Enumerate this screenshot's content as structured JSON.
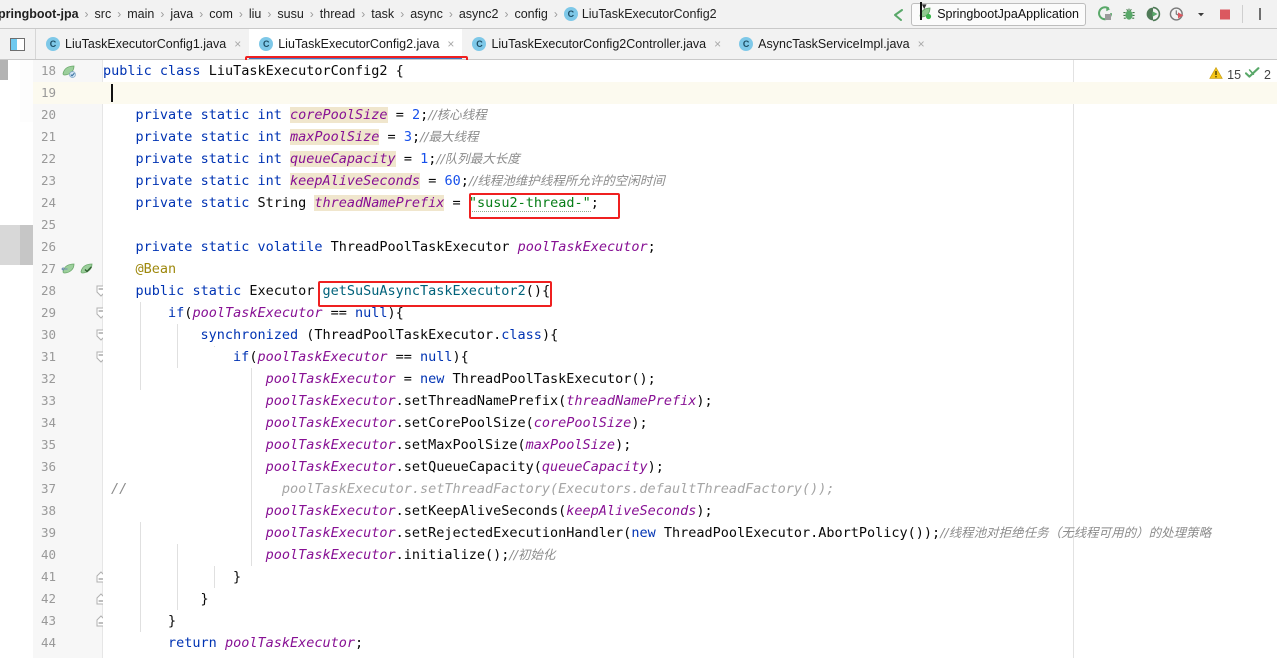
{
  "breadcrumb": {
    "items": [
      {
        "label": "pringboot-jpa",
        "icon": null
      },
      {
        "label": "src",
        "icon": null
      },
      {
        "label": "main",
        "icon": null
      },
      {
        "label": "java",
        "icon": null
      },
      {
        "label": "com",
        "icon": null
      },
      {
        "label": "liu",
        "icon": null
      },
      {
        "label": "susu",
        "icon": null
      },
      {
        "label": "thread",
        "icon": null
      },
      {
        "label": "task",
        "icon": null
      },
      {
        "label": "async",
        "icon": null
      },
      {
        "label": "async2",
        "icon": null
      },
      {
        "label": "config",
        "icon": null
      },
      {
        "label": "LiuTaskExecutorConfig2",
        "icon": "class-icon"
      }
    ],
    "separator": "›"
  },
  "toolbar": {
    "back_arrow_icon": "back-arrow-icon",
    "run_config": {
      "label": "SpringbootJpaApplication",
      "icon": "spring-leaf-icon",
      "caret": "▼"
    },
    "buttons": [
      {
        "name": "run-button",
        "icon": "run-icon"
      },
      {
        "name": "debug-button",
        "icon": "bug-icon"
      },
      {
        "name": "run-with-coverage-button",
        "icon": "coverage-icon"
      },
      {
        "name": "profiler-button",
        "icon": "profiler-icon"
      },
      {
        "name": "profiler-dropdown",
        "icon": "chevron-down-icon"
      },
      {
        "name": "stop-button",
        "icon": "stop-icon"
      }
    ]
  },
  "tabs": {
    "toolwindow_icon": "tool-window-icon",
    "items": [
      {
        "label": "LiuTaskExecutorConfig1.java",
        "icon": "class-icon",
        "active": false,
        "highlighted": false
      },
      {
        "label": "LiuTaskExecutorConfig2.java",
        "icon": "class-icon",
        "active": true,
        "highlighted": true
      },
      {
        "label": "LiuTaskExecutorConfig2Controller.java",
        "icon": "class-icon",
        "active": false,
        "highlighted": false
      },
      {
        "label": "AsyncTaskServiceImpl.java",
        "icon": "class-icon",
        "active": false,
        "highlighted": false
      }
    ],
    "close_glyph": "×"
  },
  "inspections": {
    "warning_icon": "warning-triangle-icon",
    "warning_count": "15",
    "check_icon": "inspection-check-icon",
    "check_count": "2"
  },
  "editor": {
    "first_line_number": 18,
    "caret_line": 19,
    "lines": [
      {
        "n": 18,
        "gutter": "spring-bean-icon",
        "html": "<span class=\"kw\">public</span> <span class=\"kw\">class</span> LiuTaskExecutorConfig2 {"
      },
      {
        "n": 19,
        "gutter": null,
        "html": ""
      },
      {
        "n": 20,
        "gutter": null,
        "html": "    <span class=\"kw\">private</span> <span class=\"kw\">static</span> <span class=\"kw\">int</span> <span class=\"fld fldbg\">corePoolSize</span> = <span class=\"num\">2</span>;<span class=\"cmt-cn\">//核心线程</span>"
      },
      {
        "n": 21,
        "gutter": null,
        "html": "    <span class=\"kw\">private</span> <span class=\"kw\">static</span> <span class=\"kw\">int</span> <span class=\"fld fldbg\">maxPoolSize</span> = <span class=\"num\">3</span>;<span class=\"cmt-cn\">//最大线程</span>"
      },
      {
        "n": 22,
        "gutter": null,
        "html": "    <span class=\"kw\">private</span> <span class=\"kw\">static</span> <span class=\"kw\">int</span> <span class=\"fld fldbg\">queueCapacity</span> = <span class=\"num\">1</span>;<span class=\"cmt-cn\">//队列最大长度</span>"
      },
      {
        "n": 23,
        "gutter": null,
        "html": "    <span class=\"kw\">private</span> <span class=\"kw\">static</span> <span class=\"kw\">int</span> <span class=\"fld fldbg\">keepAliveSeconds</span> = <span class=\"num\">60</span>;<span class=\"cmt-cn\">//线程池维护线程所允许的空闲时间</span>"
      },
      {
        "n": 24,
        "gutter": null,
        "html": "    <span class=\"kw\">private</span> <span class=\"kw\">static</span> String <span class=\"fld fldbg\">threadNamePrefix</span> = <span class=\"str sqw\">\"susu2-thread-\"</span>;"
      },
      {
        "n": 25,
        "gutter": null,
        "html": ""
      },
      {
        "n": 26,
        "gutter": null,
        "html": "    <span class=\"kw\">private</span> <span class=\"kw\">static</span> <span class=\"kw\">volatile</span> ThreadPoolTaskExecutor <span class=\"fld\">poolTaskExecutor</span>;"
      },
      {
        "n": 27,
        "gutter": "spring-bean-icons",
        "html": "    <span class=\"ann\">@Bean</span>"
      },
      {
        "n": 28,
        "gutter": "fold",
        "html": "    <span class=\"kw\">public</span> <span class=\"kw\">static</span> Executor <span class=\"mtd\">getSuSuAsyncTaskExecutor2</span>(){"
      },
      {
        "n": 29,
        "gutter": "fold",
        "html": "        <span class=\"kw\">if</span>(<span class=\"fld\">poolTaskExecutor</span> == <span class=\"kw\">null</span>){"
      },
      {
        "n": 30,
        "gutter": "fold",
        "html": "            <span class=\"kw\">synchronized</span> (ThreadPoolTaskExecutor.<span class=\"kw\">class</span>){"
      },
      {
        "n": 31,
        "gutter": "fold",
        "html": "                <span class=\"kw\">if</span>(<span class=\"fld\">poolTaskExecutor</span> == <span class=\"kw\">null</span>){"
      },
      {
        "n": 32,
        "gutter": null,
        "html": "                    <span class=\"fld\">poolTaskExecutor</span> = <span class=\"kw\">new</span> ThreadPoolTaskExecutor();"
      },
      {
        "n": 33,
        "gutter": null,
        "html": "                    <span class=\"fld\">poolTaskExecutor</span>.setThreadNamePrefix(<span class=\"fld\">threadNamePrefix</span>);"
      },
      {
        "n": 34,
        "gutter": null,
        "html": "                    <span class=\"fld\">poolTaskExecutor</span>.setCorePoolSize(<span class=\"fld\">corePoolSize</span>);"
      },
      {
        "n": 35,
        "gutter": null,
        "html": "                    <span class=\"fld\">poolTaskExecutor</span>.setMaxPoolSize(<span class=\"fld\">maxPoolSize</span>);"
      },
      {
        "n": 36,
        "gutter": null,
        "html": "                    <span class=\"fld\">poolTaskExecutor</span>.setQueueCapacity(<span class=\"fld\">queueCapacity</span>);"
      },
      {
        "n": 37,
        "gutter": "comment-slashes",
        "html": "                      <span class=\"disabled\">poolTaskExecutor.setThreadFactory(Executors.defaultThreadFactory());</span>"
      },
      {
        "n": 38,
        "gutter": null,
        "html": "                    <span class=\"fld\">poolTaskExecutor</span>.setKeepAliveSeconds(<span class=\"fld\">keepAliveSeconds</span>);"
      },
      {
        "n": 39,
        "gutter": null,
        "html": "                    <span class=\"fld\">poolTaskExecutor</span>.setRejectedExecutionHandler(<span class=\"kw\">new</span> ThreadPoolExecutor.AbortPolicy());<span class=\"cmt-cn\">//线程池对拒绝任务（无线程可用的）的处理策略</span>"
      },
      {
        "n": 40,
        "gutter": null,
        "html": "                    <span class=\"fld\">poolTaskExecutor</span>.initialize();<span class=\"cmt-cn\">//初始化</span>"
      },
      {
        "n": 41,
        "gutter": "fold-end",
        "html": "                }"
      },
      {
        "n": 42,
        "gutter": "fold-end",
        "html": "            }"
      },
      {
        "n": 43,
        "gutter": "fold-end",
        "html": "        }"
      },
      {
        "n": 44,
        "gutter": null,
        "html": "        <span class=\"kw\">return</span> <span class=\"fld\">poolTaskExecutor</span>;"
      }
    ],
    "line37_gutter_text": "//"
  },
  "highlights": [
    {
      "name": "tab-highlight",
      "target": "tab LiuTaskExecutorConfig2.java"
    },
    {
      "name": "string-value-highlight",
      "target": "\"susu2-thread-\""
    },
    {
      "name": "method-name-highlight",
      "target": "getSuSuAsyncTaskExecutor2()"
    }
  ],
  "colors": {
    "highlight_red": "#ef2020",
    "active_tab_underline": "#3d78c8",
    "keyword_blue": "#0033b3",
    "field_purple": "#871094",
    "string_green": "#067d17",
    "comment_gray": "#8c8c8c",
    "annotation_gold": "#9e880d",
    "method_teal": "#00627a",
    "caret_line_bg": "#fcfaef",
    "field_bg": "#f0e6cd"
  }
}
